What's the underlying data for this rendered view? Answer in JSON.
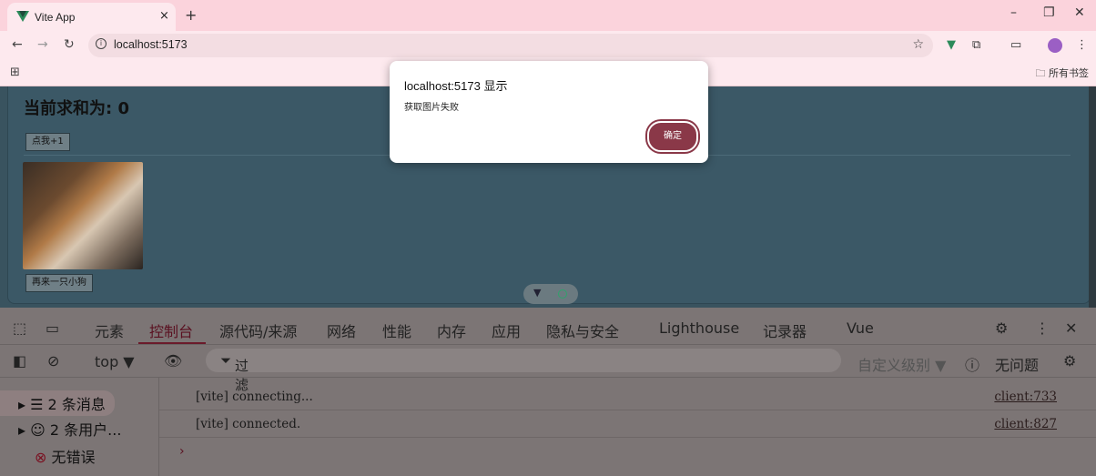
{
  "browser": {
    "tab_title": "Vite App",
    "tab_close": "×",
    "new_tab": "+",
    "url": "localhost:5173",
    "bookmarks_all": "所有书签",
    "window_controls": [
      "–",
      "❐",
      "✕"
    ]
  },
  "page": {
    "sum_title": "当前求和为: 0",
    "plus_button": "点我+1",
    "dog_button": "再来一只小狗"
  },
  "dialog": {
    "title": "localhost:5173 显示",
    "message": "获取图片失败",
    "ok": "确定"
  },
  "devtools": {
    "tabs": [
      "元素",
      "控制台",
      "源代码/来源",
      "网络",
      "性能",
      "内存",
      "应用",
      "隐私与安全",
      "Lighthouse",
      "记录器",
      "Vue"
    ],
    "context": "top ▼",
    "filter_placeholder": "过滤",
    "levels": "自定义级别 ▼",
    "issues": "无问题",
    "sidebar": [
      "2 条消息",
      "2 条用户...",
      "无错误"
    ],
    "logs": [
      {
        "msg": "[vite] connecting...",
        "src": "client:733"
      },
      {
        "msg": "[vite] connected.",
        "src": "client:827"
      }
    ],
    "prompt": "›"
  }
}
